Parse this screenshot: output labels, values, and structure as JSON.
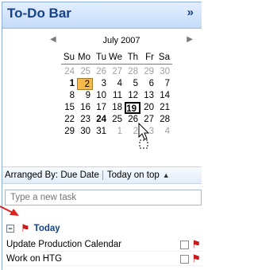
{
  "todo_bar": {
    "title": "To-Do Bar",
    "expand_icon": "»"
  },
  "calendar": {
    "month_label": "July 2007",
    "prev_icon": "◀",
    "next_icon": "▶",
    "weekdays": [
      "Su",
      "Mo",
      "Tu",
      "We",
      "Th",
      "Fr",
      "Sa"
    ],
    "weeks": [
      [
        {
          "d": "24",
          "dim": true
        },
        {
          "d": "25",
          "dim": true
        },
        {
          "d": "26",
          "dim": true
        },
        {
          "d": "27",
          "dim": true
        },
        {
          "d": "28",
          "dim": true
        },
        {
          "d": "29",
          "dim": true
        },
        {
          "d": "30",
          "dim": true
        }
      ],
      [
        {
          "d": "1",
          "bold": true
        },
        {
          "d": "2",
          "sel": true
        },
        {
          "d": "3"
        },
        {
          "d": "4"
        },
        {
          "d": "5"
        },
        {
          "d": "6"
        },
        {
          "d": "7"
        }
      ],
      [
        {
          "d": "8"
        },
        {
          "d": "9"
        },
        {
          "d": "10"
        },
        {
          "d": "11"
        },
        {
          "d": "12"
        },
        {
          "d": "13"
        },
        {
          "d": "14"
        }
      ],
      [
        {
          "d": "15"
        },
        {
          "d": "16"
        },
        {
          "d": "17"
        },
        {
          "d": "18"
        },
        {
          "d": "19",
          "today": true
        },
        {
          "d": "20"
        },
        {
          "d": "21"
        }
      ],
      [
        {
          "d": "22"
        },
        {
          "d": "23"
        },
        {
          "d": "24",
          "bold": true
        },
        {
          "d": "25"
        },
        {
          "d": "26"
        },
        {
          "d": "27"
        },
        {
          "d": "28"
        }
      ],
      [
        {
          "d": "29"
        },
        {
          "d": "30"
        },
        {
          "d": "31"
        },
        {
          "d": "1",
          "dim": true
        },
        {
          "d": "2",
          "dim": true
        },
        {
          "d": "3",
          "dim": true
        },
        {
          "d": "4",
          "dim": true
        }
      ]
    ]
  },
  "arrange": {
    "left_label": "Arranged By: Due Date",
    "right_label": "Today on top",
    "scroll_icon": "▲"
  },
  "new_task": {
    "placeholder": "Type a new task"
  },
  "group": {
    "toggle": "−",
    "flag_icon": "⚑",
    "label": "Today"
  },
  "tasks": [
    {
      "label": "Update Production Calendar",
      "flag_icon": "⚑"
    },
    {
      "label": "Work on HTG",
      "flag_icon": "⚑"
    }
  ],
  "colors": {
    "title_text": "#15428b",
    "selected_day": "#f5b84b",
    "flag": "#cc1a1a",
    "annotation_arrow": "#e0201c"
  }
}
